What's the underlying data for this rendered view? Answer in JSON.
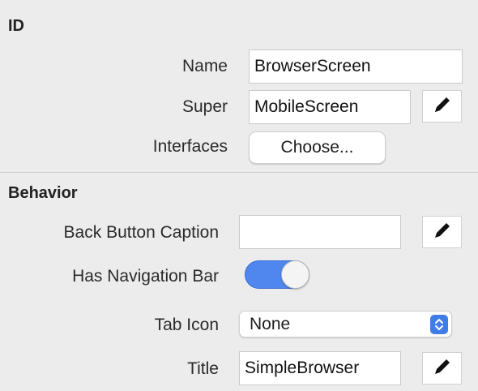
{
  "id_section": {
    "title": "ID",
    "name_label": "Name",
    "name_value": "BrowserScreen",
    "super_label": "Super",
    "super_value": "MobileScreen",
    "interfaces_label": "Interfaces",
    "choose_button": "Choose..."
  },
  "behavior_section": {
    "title": "Behavior",
    "back_caption_label": "Back Button Caption",
    "back_caption_value": "",
    "nav_bar_label": "Has Navigation Bar",
    "nav_bar_on": true,
    "tab_icon_label": "Tab Icon",
    "tab_icon_value": "None",
    "title_label": "Title",
    "title_value": "SimpleBrowser"
  },
  "icons": {
    "edit": "pencil-icon",
    "popup": "up-down-chevron-icon"
  },
  "colors": {
    "background": "#ececec",
    "accent": "#4f87ef"
  }
}
